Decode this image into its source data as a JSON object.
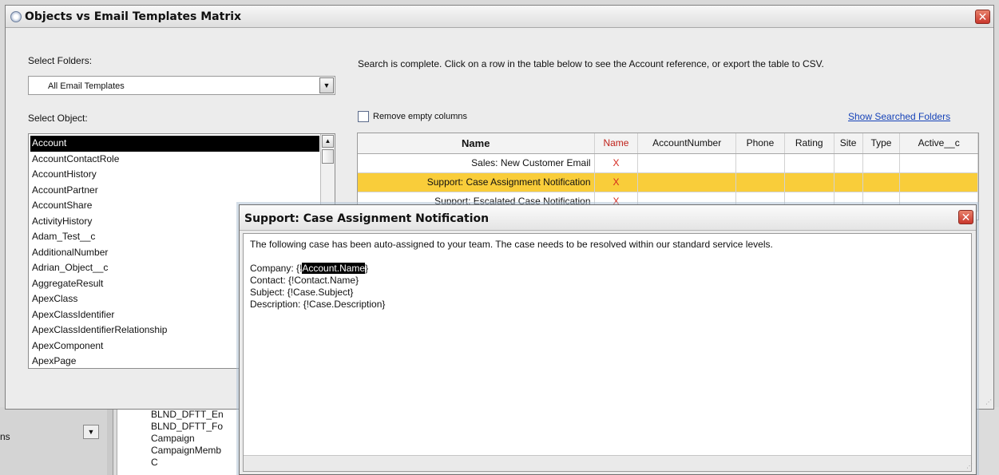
{
  "background": {
    "dropdown_fragment": "ns",
    "object_list": [
      "BLND_DFTT_En",
      "BLND_DFTT_Fo",
      "Campaign",
      "CampaignMemb",
      "C"
    ]
  },
  "dialog": {
    "title": "Objects vs Email Templates Matrix",
    "close_glyph": "✕",
    "select_folders_label": "Select Folders:",
    "folder_dropdown_value": "All Email Templates",
    "select_object_label": "Select Object:",
    "objects": [
      "Account",
      "AccountContactRole",
      "AccountHistory",
      "AccountPartner",
      "AccountShare",
      "ActivityHistory",
      "Adam_Test__c",
      "AdditionalNumber",
      "Adrian_Object__c",
      "AggregateResult",
      "ApexClass",
      "ApexClassIdentifier",
      "ApexClassIdentifierRelationship",
      "ApexComponent",
      "ApexPage"
    ],
    "selected_object": "Account",
    "status_message": "Search is complete. Click on a row in the table below to see the Account reference, or export the table to CSV.",
    "remove_empty_label": "Remove empty columns",
    "show_folders_link": "Show Searched Folders",
    "table": {
      "columns": [
        "Name",
        "Name",
        "AccountNumber",
        "Phone",
        "Rating",
        "Site",
        "Type",
        "Active__c"
      ],
      "rows": [
        {
          "name": "Sales: New Customer Email",
          "marks": [
            "X",
            "",
            "",
            "",
            "",
            "",
            ""
          ]
        },
        {
          "name": "Support: Case Assignment Notification",
          "marks": [
            "X",
            "",
            "",
            "",
            "",
            "",
            ""
          ],
          "highlighted": true
        },
        {
          "name": "Support: Escalated Case Notification",
          "marks": [
            "X",
            "",
            "",
            "",
            "",
            "",
            ""
          ]
        }
      ]
    }
  },
  "popup": {
    "title": "Support: Case Assignment Notification",
    "close_glyph": "✕",
    "intro": "The following case has been auto-assigned to your team.  The case needs to be resolved within our standard service levels.",
    "company_prefix": "Company: {!",
    "company_field": "Account.Name",
    "company_suffix": "}",
    "contact_line": "Contact: {!Contact.Name}",
    "subject_line": "Subject: {!Case.Subject}",
    "description_line": "Description: {!Case.Description}"
  },
  "colors": {
    "highlight_row": "#f9cd3a",
    "x_mark": "#d52a1f",
    "link": "#1542b8",
    "close_button": "#c9372c"
  },
  "icons": [
    "gear-icon",
    "close-icon",
    "chevron-down-icon",
    "chevron-up-icon"
  ]
}
